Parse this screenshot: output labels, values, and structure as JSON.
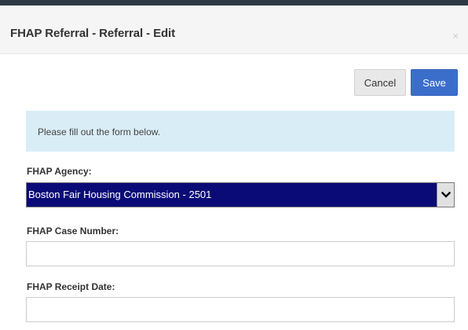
{
  "modal": {
    "title": "FHAP Referral - Referral - Edit",
    "close_icon": "×"
  },
  "toolbar": {
    "cancel_label": "Cancel",
    "save_label": "Save"
  },
  "notice": {
    "text": "Please fill out the form below."
  },
  "form": {
    "agency": {
      "label": "FHAP Agency:",
      "selected": "Boston Fair Housing Commission - 2501"
    },
    "case_number": {
      "label": "FHAP Case Number:",
      "value": ""
    },
    "receipt_date": {
      "label": "FHAP Receipt Date:",
      "value": ""
    }
  },
  "colors": {
    "header_bar": "#2f3a45",
    "save_button": "#3b6ecb",
    "notice_bg": "#d9edf7",
    "select_highlight": "#0b0b78"
  }
}
